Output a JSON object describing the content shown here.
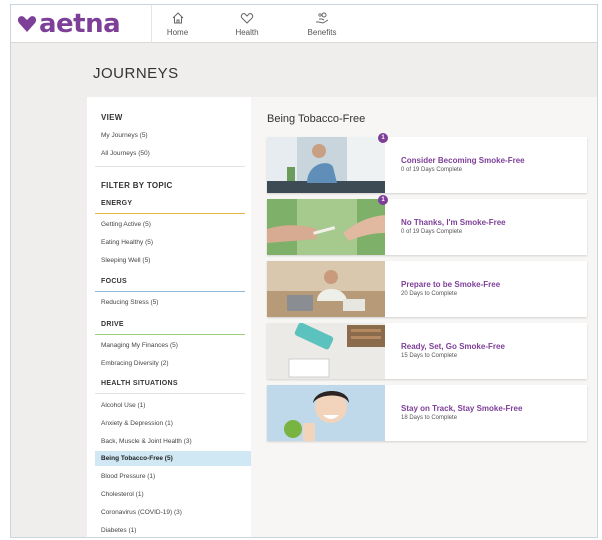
{
  "brand": {
    "name": "aetna",
    "color": "#7d3f98"
  },
  "nav": [
    {
      "label": "Home",
      "icon": "home-icon"
    },
    {
      "label": "Health",
      "icon": "heart-icon"
    },
    {
      "label": "Benefits",
      "icon": "hand-coins-icon"
    }
  ],
  "page_title": "JOURNEYS",
  "sidebar": {
    "view_heading": "VIEW",
    "my_journeys": "My Journeys (5)",
    "all_journeys": "All Journeys (50)",
    "filter_heading": "FILTER BY TOPIC",
    "energy": {
      "heading": "ENERGY",
      "items": [
        "Getting Active (5)",
        "Eating Healthy (5)",
        "Sleeping Well (5)"
      ]
    },
    "focus": {
      "heading": "FOCUS",
      "items": [
        "Reducing Stress (5)"
      ]
    },
    "drive": {
      "heading": "DRIVE",
      "items": [
        "Managing My Finances (5)",
        "Embracing Diversity (2)"
      ]
    },
    "health": {
      "heading": "HEALTH SITUATIONS",
      "items": [
        "Alcohol Use (1)",
        "Anxiety & Depression (1)",
        "Back, Muscle & Joint Health (3)",
        "Being Tobacco-Free (5)",
        "Blood Pressure (1)",
        "Cholesterol (1)",
        "Coronavirus (COVID-19) (3)",
        "Diabetes (1)"
      ],
      "selected": "Being Tobacco-Free (5)"
    }
  },
  "main": {
    "title": "Being Tobacco-Free",
    "cards": [
      {
        "title": "Consider Becoming Smoke-Free",
        "subtitle": "0 of 19 Days Complete",
        "badge": "1"
      },
      {
        "title": "No Thanks, I'm Smoke-Free",
        "subtitle": "0 of 19 Days Complete",
        "badge": "1"
      },
      {
        "title": "Prepare to be Smoke-Free",
        "subtitle": "20 Days to Complete"
      },
      {
        "title": "Ready, Set, Go Smoke-Free",
        "subtitle": "15 Days to Complete"
      },
      {
        "title": "Stay on Track, Stay Smoke-Free",
        "subtitle": "18 Days to Complete"
      }
    ]
  },
  "colors": {
    "energy_rule": "#e8b54a",
    "focus_rule": "#8fb8d8",
    "drive_rule": "#9ccf7a",
    "selected_bg": "#cfe8f3"
  }
}
